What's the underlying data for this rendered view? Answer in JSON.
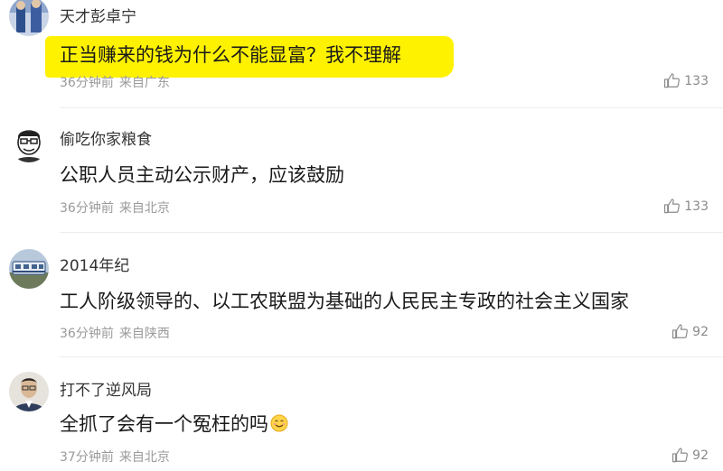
{
  "comments": [
    {
      "username": "天才彭卓宁",
      "text": "正当赚来的钱为什么不能显富？我不理解",
      "time": "36分钟前",
      "location": "来自广东",
      "likes": "133",
      "highlighted": true
    },
    {
      "username": "偷吃你家粮食",
      "text": "公职人员主动公示财产，应该鼓励",
      "time": "36分钟前",
      "location": "来自北京",
      "likes": "133",
      "highlighted": false
    },
    {
      "username": "2014年纪",
      "text": "工人阶级领导的、以工农联盟为基础的人民民主专政的社会主义国家",
      "time": "36分钟前",
      "location": "来自陕西",
      "likes": "92",
      "highlighted": false
    },
    {
      "username": "打不了逆风局",
      "text": "全抓了会有一个冤枉的吗",
      "time": "37分钟前",
      "location": "来自北京",
      "likes": "92",
      "highlighted": false,
      "trailing_icon": "smile-emoji-icon"
    }
  ],
  "colors": {
    "highlight": "#fff200",
    "meta_text": "#9a9a9a",
    "divider": "#ececec"
  }
}
